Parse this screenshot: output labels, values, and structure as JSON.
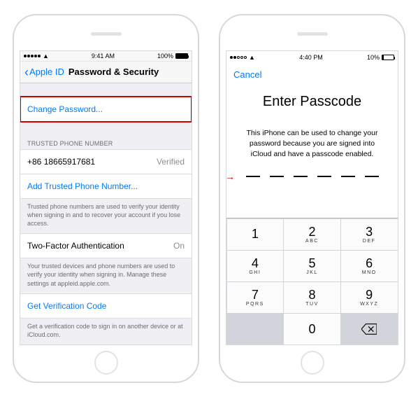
{
  "left": {
    "status": {
      "time": "9:41 AM",
      "battery_pct": "100%",
      "battery_fill": "100%"
    },
    "nav": {
      "back_label": "Apple ID",
      "title": "Password & Security"
    },
    "change_password": "Change Password...",
    "trusted_header": "TRUSTED PHONE NUMBER",
    "phone_number": "+86 18665917681",
    "phone_status": "Verified",
    "add_trusted": "Add Trusted Phone Number...",
    "trusted_footer": "Trusted phone numbers are used to verify your identity when signing in and to recover your account if you lose access.",
    "two_factor_label": "Two-Factor Authentication",
    "two_factor_value": "On",
    "two_factor_footer": "Your trusted devices and phone numbers are used to verify your identity when signing in. Manage these settings at appleid.apple.com.",
    "get_code": "Get Verification Code",
    "get_code_footer": "Get a verification code to sign in on another device or at iCloud.com."
  },
  "right": {
    "status": {
      "time": "4:40 PM",
      "battery_pct": "10%",
      "battery_fill": "10%"
    },
    "cancel": "Cancel",
    "title": "Enter Passcode",
    "desc": "This iPhone can be used to change your password because you are signed into iCloud and have a passcode enabled.",
    "keypad": [
      [
        {
          "n": "1",
          "l": ""
        },
        {
          "n": "2",
          "l": "ABC"
        },
        {
          "n": "3",
          "l": "DEF"
        }
      ],
      [
        {
          "n": "4",
          "l": "GHI"
        },
        {
          "n": "5",
          "l": "JKL"
        },
        {
          "n": "6",
          "l": "MNO"
        }
      ],
      [
        {
          "n": "7",
          "l": "PQRS"
        },
        {
          "n": "8",
          "l": "TUV"
        },
        {
          "n": "9",
          "l": "WXYZ"
        }
      ]
    ],
    "zero": {
      "n": "0",
      "l": ""
    }
  }
}
